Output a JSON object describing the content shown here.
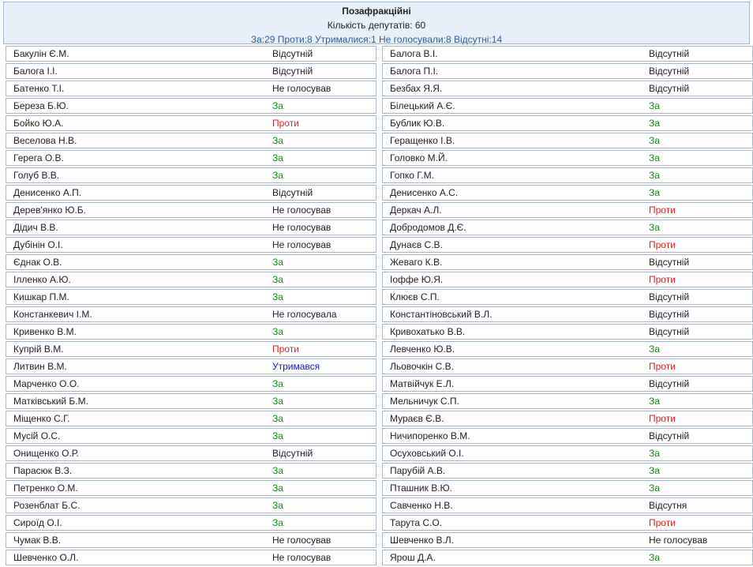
{
  "header": {
    "title": "Позафракційні",
    "count": "Кількість депутатів: 60",
    "summary": "За:29 Проти:8 Утрималися:1 Не голосували:8 Відсутні:14"
  },
  "colors": {
    "za": "#1a8a1a",
    "proty": "#e02020",
    "utrymavsia": "#1a1aa8",
    "header_bg": "#e8f1fa",
    "border": "#a8b8c8"
  },
  "left": [
    {
      "name": "Бакулін Є.М.",
      "vote": "Відсутній",
      "type": "abs"
    },
    {
      "name": "Балога І.І.",
      "vote": "Відсутній",
      "type": "abs"
    },
    {
      "name": "Батенко Т.І.",
      "vote": "Не голосував",
      "type": "ng"
    },
    {
      "name": "Береза Б.Ю.",
      "vote": "За",
      "type": "za"
    },
    {
      "name": "Бойко Ю.А.",
      "vote": "Проти",
      "type": "proty"
    },
    {
      "name": "Веселова Н.В.",
      "vote": "За",
      "type": "za"
    },
    {
      "name": "Герега О.В.",
      "vote": "За",
      "type": "za"
    },
    {
      "name": "Голуб В.В.",
      "vote": "За",
      "type": "za"
    },
    {
      "name": "Денисенко А.П.",
      "vote": "Відсутній",
      "type": "abs"
    },
    {
      "name": "Дерев'янко Ю.Б.",
      "vote": "Не голосував",
      "type": "ng"
    },
    {
      "name": "Дідич В.В.",
      "vote": "Не голосував",
      "type": "ng"
    },
    {
      "name": "Дубінін О.І.",
      "vote": "Не голосував",
      "type": "ng"
    },
    {
      "name": "Єднак О.В.",
      "vote": "За",
      "type": "za"
    },
    {
      "name": "Ілленко А.Ю.",
      "vote": "За",
      "type": "za"
    },
    {
      "name": "Кишкар П.М.",
      "vote": "За",
      "type": "za"
    },
    {
      "name": "Констанкевич І.М.",
      "vote": "Не голосувала",
      "type": "ng"
    },
    {
      "name": "Кривенко В.М.",
      "vote": "За",
      "type": "za"
    },
    {
      "name": "Купрій В.М.",
      "vote": "Проти",
      "type": "proty"
    },
    {
      "name": "Литвин В.М.",
      "vote": "Утримався",
      "type": "utr"
    },
    {
      "name": "Марченко О.О.",
      "vote": "За",
      "type": "za"
    },
    {
      "name": "Матківський Б.М.",
      "vote": "За",
      "type": "za"
    },
    {
      "name": "Міщенко С.Г.",
      "vote": "За",
      "type": "za"
    },
    {
      "name": "Мусій О.С.",
      "vote": "За",
      "type": "za"
    },
    {
      "name": "Онищенко О.Р.",
      "vote": "Відсутній",
      "type": "abs"
    },
    {
      "name": "Парасюк В.З.",
      "vote": "За",
      "type": "za"
    },
    {
      "name": "Петренко О.М.",
      "vote": "За",
      "type": "za"
    },
    {
      "name": "Розенблат Б.С.",
      "vote": "За",
      "type": "za"
    },
    {
      "name": "Сироїд О.І.",
      "vote": "За",
      "type": "za"
    },
    {
      "name": "Чумак В.В.",
      "vote": "Не голосував",
      "type": "ng"
    },
    {
      "name": "Шевченко О.Л.",
      "vote": "Не голосував",
      "type": "ng"
    }
  ],
  "right": [
    {
      "name": "Балога В.І.",
      "vote": "Відсутній",
      "type": "abs"
    },
    {
      "name": "Балога П.І.",
      "vote": "Відсутній",
      "type": "abs"
    },
    {
      "name": "Безбах Я.Я.",
      "vote": "Відсутній",
      "type": "abs"
    },
    {
      "name": "Білецький А.Є.",
      "vote": "За",
      "type": "za"
    },
    {
      "name": "Бублик Ю.В.",
      "vote": "За",
      "type": "za"
    },
    {
      "name": "Геращенко І.В.",
      "vote": "За",
      "type": "za"
    },
    {
      "name": "Головко М.Й.",
      "vote": "За",
      "type": "za"
    },
    {
      "name": "Гопко Г.М.",
      "vote": "За",
      "type": "za"
    },
    {
      "name": "Денисенко А.С.",
      "vote": "За",
      "type": "za"
    },
    {
      "name": "Деркач А.Л.",
      "vote": "Проти",
      "type": "proty"
    },
    {
      "name": "Добродомов Д.Є.",
      "vote": "За",
      "type": "za"
    },
    {
      "name": "Дунаєв С.В.",
      "vote": "Проти",
      "type": "proty"
    },
    {
      "name": "Жеваго К.В.",
      "vote": "Відсутній",
      "type": "abs"
    },
    {
      "name": "Іоффе Ю.Я.",
      "vote": "Проти",
      "type": "proty"
    },
    {
      "name": "Клюєв С.П.",
      "vote": "Відсутній",
      "type": "abs"
    },
    {
      "name": "Константіновський В.Л.",
      "vote": "Відсутній",
      "type": "abs"
    },
    {
      "name": "Кривохатько В.В.",
      "vote": "Відсутній",
      "type": "abs"
    },
    {
      "name": "Левченко Ю.В.",
      "vote": "За",
      "type": "za"
    },
    {
      "name": "Льовочкін С.В.",
      "vote": "Проти",
      "type": "proty"
    },
    {
      "name": "Матвійчук Е.Л.",
      "vote": "Відсутній",
      "type": "abs"
    },
    {
      "name": "Мельничук С.П.",
      "vote": "За",
      "type": "za"
    },
    {
      "name": "Мураєв Є.В.",
      "vote": "Проти",
      "type": "proty"
    },
    {
      "name": "Ничипоренко В.М.",
      "vote": "Відсутній",
      "type": "abs"
    },
    {
      "name": "Осуховський О.І.",
      "vote": "За",
      "type": "za"
    },
    {
      "name": "Парубій А.В.",
      "vote": "За",
      "type": "za"
    },
    {
      "name": "Пташник В.Ю.",
      "vote": "За",
      "type": "za"
    },
    {
      "name": "Савченко Н.В.",
      "vote": "Відсутня",
      "type": "abs"
    },
    {
      "name": "Тарута С.О.",
      "vote": "Проти",
      "type": "proty"
    },
    {
      "name": "Шевченко В.Л.",
      "vote": "Не голосував",
      "type": "ng"
    },
    {
      "name": "Ярош Д.А.",
      "vote": "За",
      "type": "za"
    }
  ]
}
